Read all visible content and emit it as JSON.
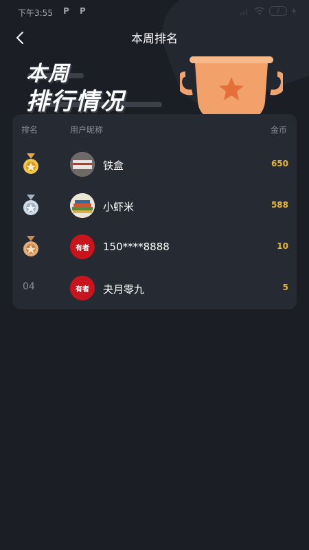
{
  "status": {
    "time": "下午3:55",
    "p1": "P",
    "p2": "P",
    "battery": "2"
  },
  "nav": {
    "title": "本周排名"
  },
  "banner": {
    "line1": "本周",
    "line2": "排行情况"
  },
  "table": {
    "headers": {
      "rank": "排名",
      "name": "用户昵称",
      "coins": "金币"
    },
    "rows": [
      {
        "rank": "01",
        "medal": "gold-medal-icon",
        "name": "铁盒",
        "coins": "650",
        "avatar_text": ""
      },
      {
        "rank": "02",
        "medal": "silver-medal-icon",
        "name": "小虾米",
        "coins": "588",
        "avatar_text": ""
      },
      {
        "rank": "03",
        "medal": "bronze-medal-icon",
        "name": "150****8888",
        "coins": "10",
        "avatar_text": "有者"
      },
      {
        "rank": "04",
        "medal": "",
        "name": "夬月零九",
        "coins": "5",
        "avatar_text": "有者"
      }
    ]
  },
  "colors": {
    "accent_coin": "#e7b63b",
    "background": "#1b1e24",
    "card": "#262a32"
  }
}
